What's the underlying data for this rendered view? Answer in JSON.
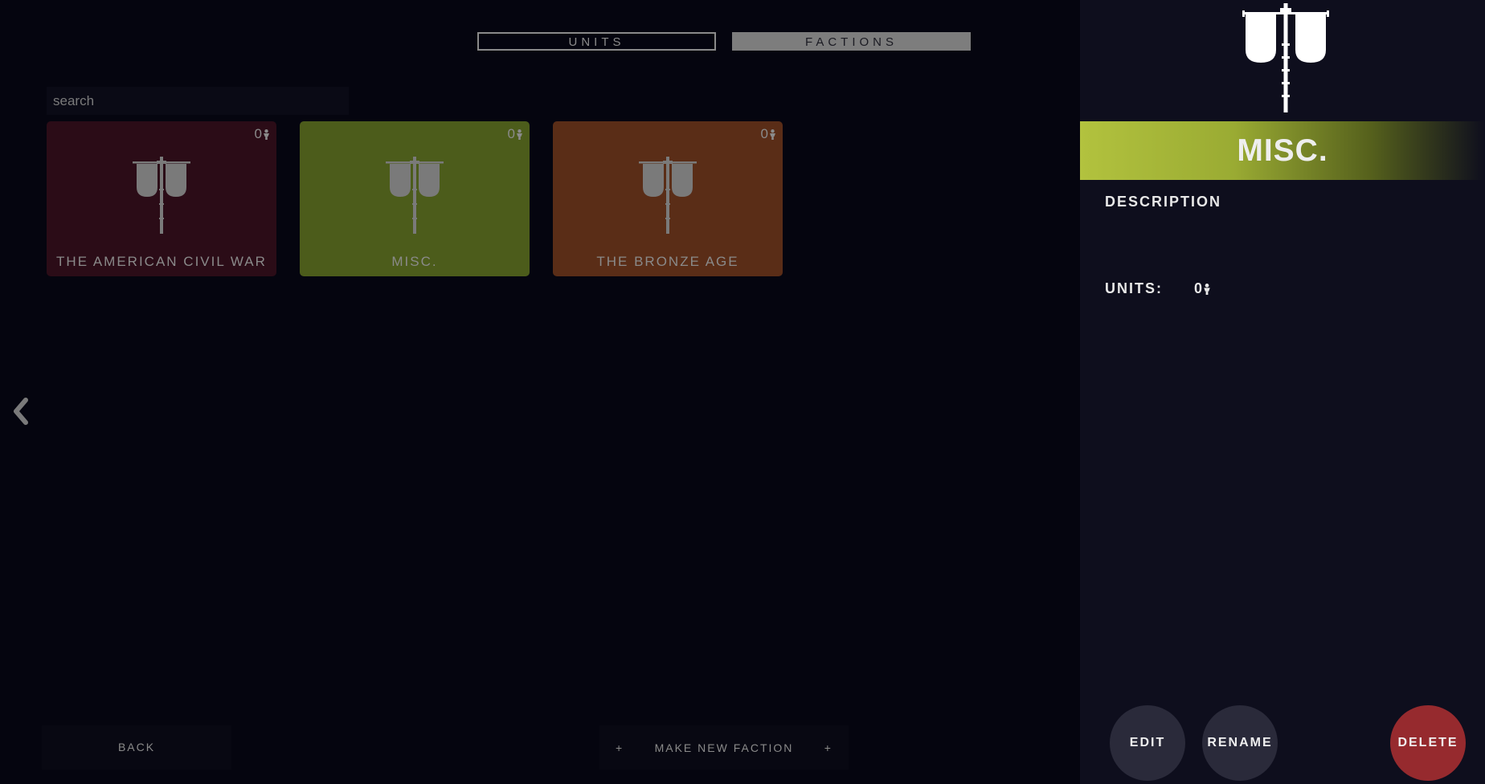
{
  "tabs": {
    "units": "UNITS",
    "factions": "FACTIONS"
  },
  "search": {
    "placeholder": "search",
    "value": ""
  },
  "factions": [
    {
      "name": "THE AMERICAN CIVIL WAR",
      "count": "0",
      "color": "#2b0c17"
    },
    {
      "name": "MISC.",
      "count": "0",
      "color": "#4c5c1b"
    },
    {
      "name": "THE BRONZE AGE",
      "count": "0",
      "color": "#5a2d17"
    }
  ],
  "footer": {
    "back_label": "BACK",
    "make_new_plus_left": "+",
    "make_new_label": "MAKE NEW FACTION",
    "make_new_plus_right": "+"
  },
  "sidebar": {
    "title": "MISC.",
    "header_color": "#b2c23e",
    "description_label": "DESCRIPTION",
    "description": "",
    "units_label": "UNITS:",
    "units_count": "0",
    "edit_label": "EDIT",
    "rename_label": "RENAME",
    "delete_label": "DELETE",
    "delete_color": "#962a2e"
  },
  "icons": {
    "banner": "banner-emblem-icon",
    "unit": "unit-figure-icon",
    "back": "chevron-left-icon"
  }
}
